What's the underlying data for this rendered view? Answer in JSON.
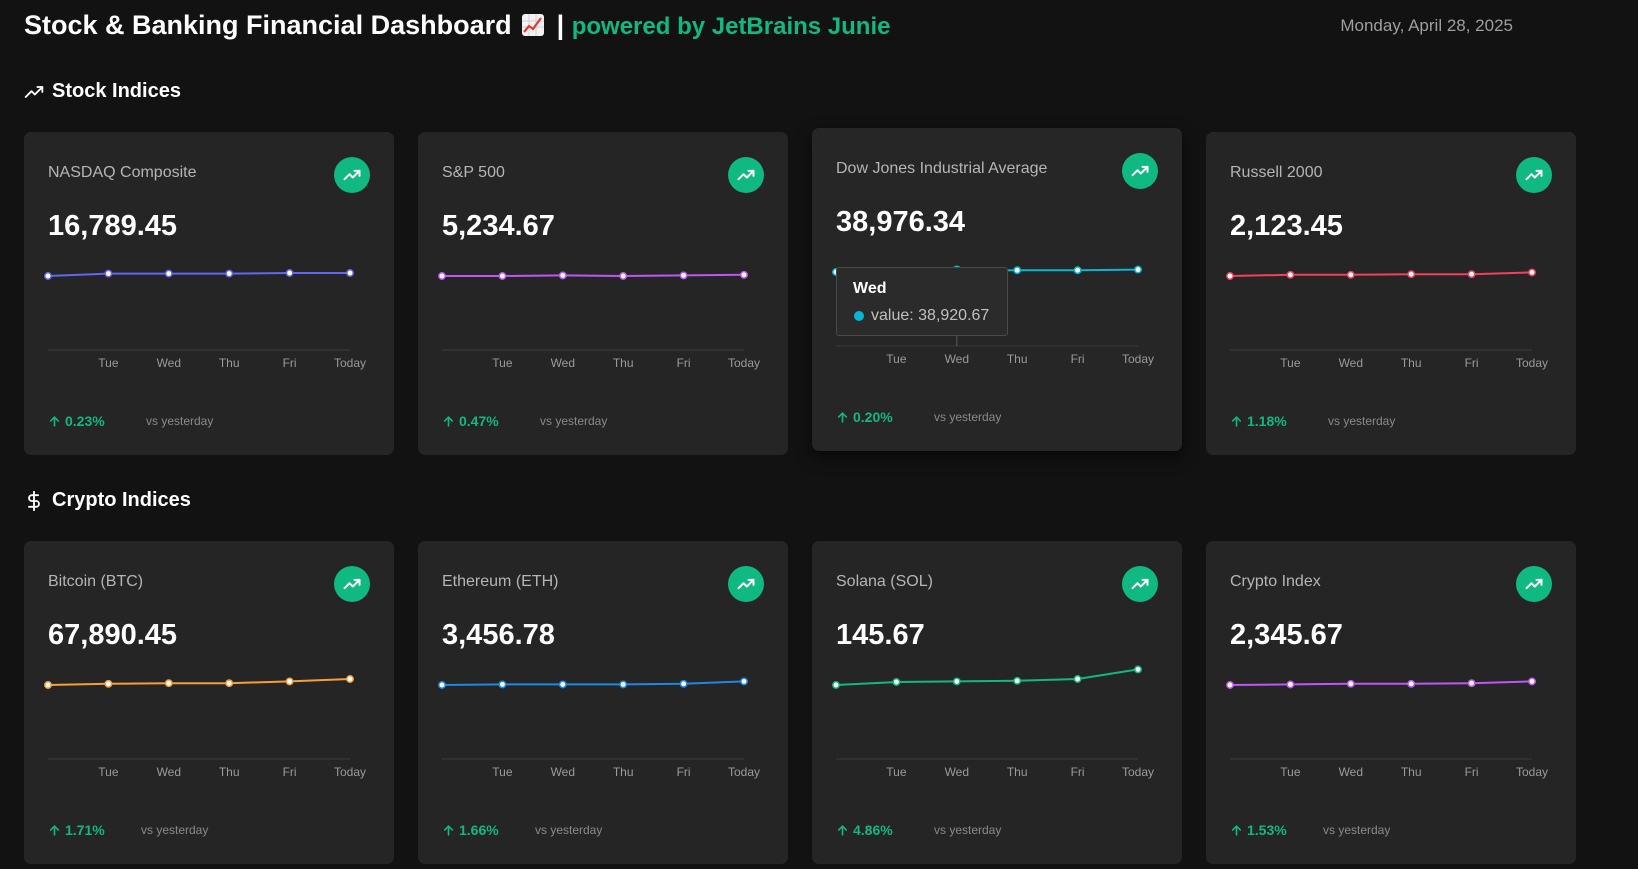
{
  "header": {
    "title": "Stock & Banking Financial Dashboard",
    "separator": "|",
    "powered_by": "powered by JetBrains Junie",
    "date": "Monday, April 28, 2025"
  },
  "sections": {
    "stocks": {
      "title": "Stock Indices",
      "icon": "trending-up-icon"
    },
    "crypto": {
      "title": "Crypto Indices",
      "icon": "dollar-icon"
    }
  },
  "vs_label": "vs yesterday",
  "cards": [
    {
      "name": "NASDAQ Composite",
      "value": "16,789.45",
      "change": "0.23%",
      "color": "#6366f1"
    },
    {
      "name": "S&P 500",
      "value": "5,234.67",
      "change": "0.47%",
      "color": "#c155f5"
    },
    {
      "name": "Dow Jones Industrial Average",
      "value": "38,976.34",
      "change": "0.20%",
      "color": "#06b6d4"
    },
    {
      "name": "Russell 2000",
      "value": "2,123.45",
      "change": "1.18%",
      "color": "#f43f5e"
    },
    {
      "name": "Bitcoin (BTC)",
      "value": "67,890.45",
      "change": "1.71%",
      "color": "#f59e3b"
    },
    {
      "name": "Ethereum (ETH)",
      "value": "3,456.78",
      "change": "1.66%",
      "color": "#1e88e5"
    },
    {
      "name": "Solana (SOL)",
      "value": "145.67",
      "change": "4.86%",
      "color": "#10b981"
    },
    {
      "name": "Crypto Index",
      "value": "2,345.67",
      "change": "1.53%",
      "color": "#c155f5"
    }
  ],
  "tooltip": {
    "title": "Wed",
    "text": "value: 38,920.67",
    "color": "#06b6d4"
  },
  "chart_data": [
    {
      "type": "line",
      "name": "NASDAQ Composite",
      "categories": [
        "",
        "Tue",
        "Wed",
        "Thu",
        "Fri",
        "Today"
      ],
      "values": [
        0.0,
        0.04,
        0.04,
        0.04,
        0.05,
        0.05
      ]
    },
    {
      "type": "line",
      "name": "S&P 500",
      "categories": [
        "",
        "Tue",
        "Wed",
        "Thu",
        "Fri",
        "Today"
      ],
      "values": [
        0.0,
        0.0,
        0.01,
        0.0,
        0.01,
        0.02
      ]
    },
    {
      "type": "line",
      "name": "Dow Jones Industrial Average",
      "categories": [
        "",
        "Tue",
        "Wed",
        "Thu",
        "Fri",
        "Today"
      ],
      "values": [
        0.0,
        0.01,
        0.02,
        0.03,
        0.03,
        0.04
      ]
    },
    {
      "type": "line",
      "name": "Russell 2000",
      "categories": [
        "",
        "Tue",
        "Wed",
        "Thu",
        "Fri",
        "Today"
      ],
      "values": [
        0.0,
        0.02,
        0.02,
        0.03,
        0.03,
        0.06
      ]
    },
    {
      "type": "line",
      "name": "Bitcoin (BTC)",
      "categories": [
        "",
        "Tue",
        "Wed",
        "Thu",
        "Fri",
        "Today"
      ],
      "values": [
        0.0,
        0.02,
        0.03,
        0.03,
        0.06,
        0.1
      ]
    },
    {
      "type": "line",
      "name": "Ethereum (ETH)",
      "categories": [
        "",
        "Tue",
        "Wed",
        "Thu",
        "Fri",
        "Today"
      ],
      "values": [
        0.0,
        0.01,
        0.01,
        0.01,
        0.02,
        0.06
      ]
    },
    {
      "type": "line",
      "name": "Solana (SOL)",
      "categories": [
        "",
        "Tue",
        "Wed",
        "Thu",
        "Fri",
        "Today"
      ],
      "values": [
        0.0,
        0.05,
        0.06,
        0.07,
        0.1,
        0.26
      ]
    },
    {
      "type": "line",
      "name": "Crypto Index",
      "categories": [
        "",
        "Tue",
        "Wed",
        "Thu",
        "Fri",
        "Today"
      ],
      "values": [
        0.0,
        0.01,
        0.02,
        0.02,
        0.03,
        0.06
      ]
    }
  ]
}
